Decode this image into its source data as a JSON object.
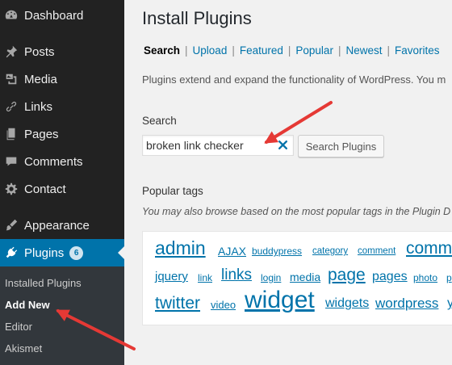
{
  "sidebar": {
    "items": [
      {
        "label": "Dashboard",
        "icon": "dashboard-icon"
      },
      {
        "label": "Posts",
        "icon": "pin-icon"
      },
      {
        "label": "Media",
        "icon": "media-icon"
      },
      {
        "label": "Links",
        "icon": "link-icon"
      },
      {
        "label": "Pages",
        "icon": "pages-icon"
      },
      {
        "label": "Comments",
        "icon": "comment-icon"
      },
      {
        "label": "Contact",
        "icon": "gear-icon"
      },
      {
        "label": "Appearance",
        "icon": "brush-icon"
      },
      {
        "label": "Plugins",
        "icon": "plugin-icon",
        "count": "6"
      }
    ],
    "submenu": [
      "Installed Plugins",
      "Add New",
      "Editor",
      "Akismet"
    ]
  },
  "main": {
    "title": "Install Plugins",
    "tabs": [
      "Search",
      "Upload",
      "Featured",
      "Popular",
      "Newest",
      "Favorites"
    ],
    "description": "Plugins extend and expand the functionality of WordPress. You m",
    "search_label": "Search",
    "search_value": "broken link checker",
    "search_button": "Search Plugins",
    "tags_heading": "Popular tags",
    "tags_description": "You may also browse based on the most popular tags in the Plugin D",
    "tags": [
      "admin",
      "AJAX",
      "buddypress",
      "category",
      "comment",
      "comm",
      "jquery",
      "link",
      "links",
      "login",
      "media",
      "page",
      "pages",
      "photo",
      "p",
      "twitter",
      "video",
      "widget",
      "widgets",
      "wordpress",
      "y"
    ]
  },
  "colors": {
    "accent": "#0073aa",
    "sidebar": "#222222",
    "arrow": "#e53935"
  }
}
